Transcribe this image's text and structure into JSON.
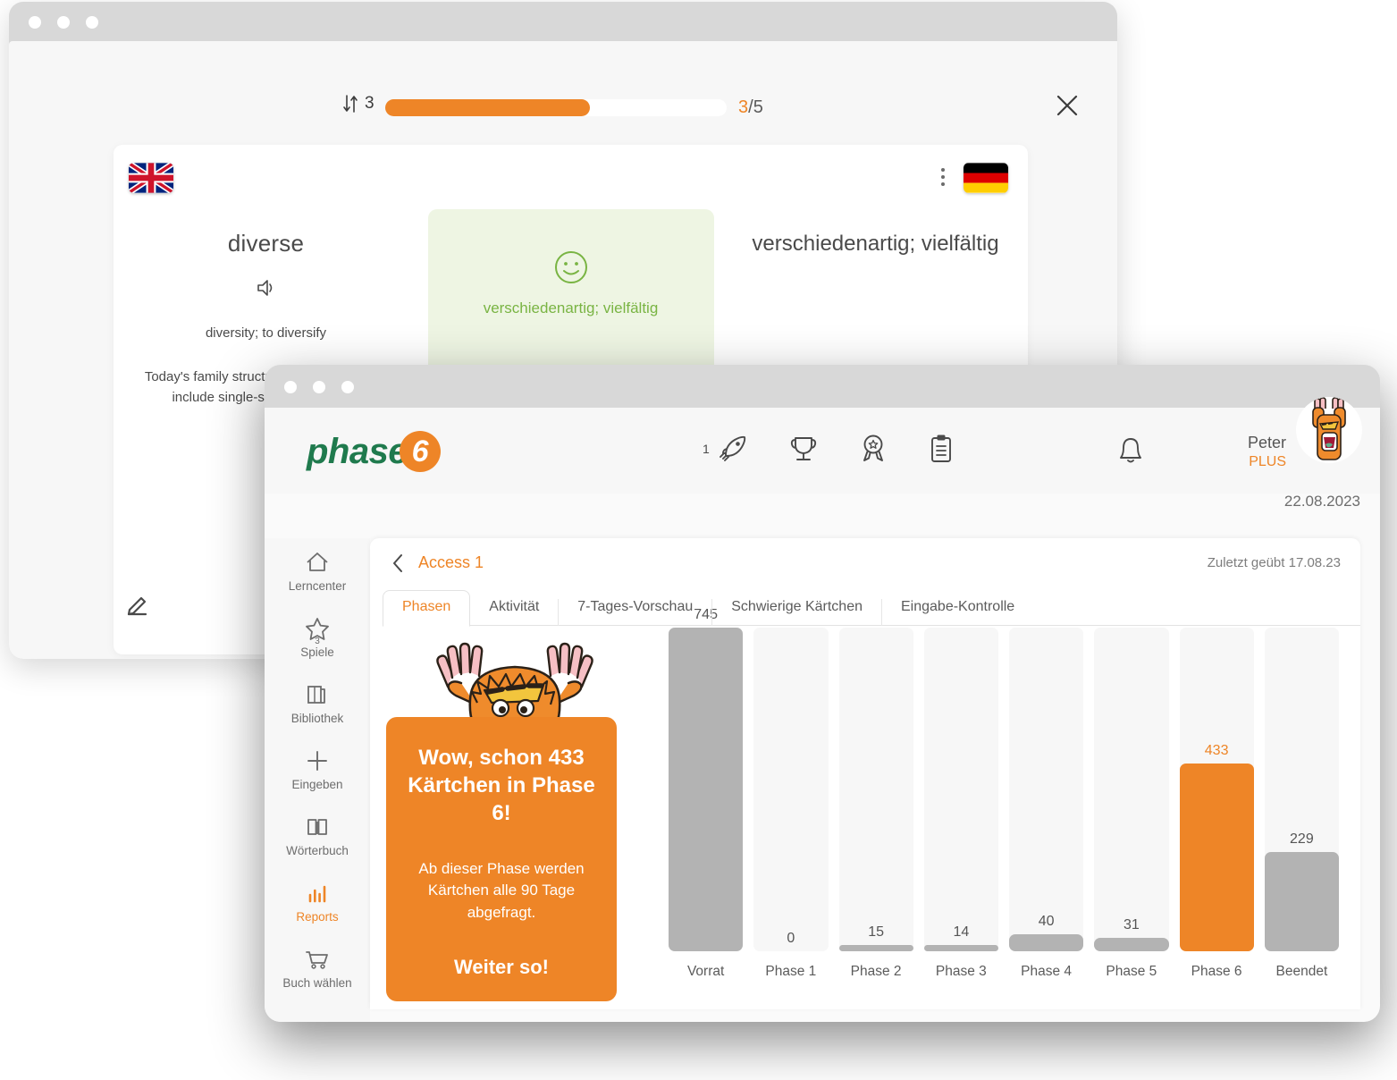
{
  "window_flashcard": {
    "title_dots": [
      "dot",
      "dot",
      "dot"
    ],
    "progress": {
      "shuffle_icon": "sort-arrows-icon",
      "shuffle_count": "3",
      "current": "3",
      "separator": "/",
      "total": "5",
      "percent": 60,
      "fill_color": "#ee8527"
    },
    "close_label": "close-icon",
    "card": {
      "source_flag": "uk-flag",
      "target_flag": "de-flag",
      "menu_icon": "kebab-menu-icon",
      "left": {
        "term": "diverse",
        "audio_icon": "speaker-icon",
        "related": "diversity; to diversify",
        "example": "Today's family structures are diverse and include single-sex partnerships."
      },
      "middle": {
        "smiley_icon": "smiley-face-icon",
        "answer": "verschiedenartig; vielfältig",
        "bg_color": "#eef5e3",
        "text_color": "#79b443"
      },
      "right": {
        "answer": "verschiedenartig; vielfältig"
      },
      "edit_icon": "pencil-icon"
    }
  },
  "window_app": {
    "logo": {
      "word": "phase",
      "digit": "6",
      "word_color": "#1f7a4d",
      "digit_bg": "#ee8527"
    },
    "header_icons": [
      {
        "name": "rocket-icon",
        "badge": "1"
      },
      {
        "name": "trophy-icon",
        "badge": ""
      },
      {
        "name": "medal-icon",
        "badge": ""
      },
      {
        "name": "clipboard-icon",
        "badge": ""
      }
    ],
    "bell_icon": "bell-icon",
    "user": {
      "name": "Peter",
      "plan": "PLUS",
      "avatar": "monster-avatar"
    },
    "today_date": "22.08.2023",
    "sidebar": {
      "items": [
        {
          "label": "Lerncenter",
          "icon": "home-icon",
          "active": false,
          "badge": ""
        },
        {
          "label": "Spiele",
          "icon": "star-icon",
          "active": false,
          "badge": "3"
        },
        {
          "label": "Bibliothek",
          "icon": "books-icon",
          "active": false,
          "badge": ""
        },
        {
          "label": "Eingeben",
          "icon": "plus-icon",
          "active": false,
          "badge": ""
        },
        {
          "label": "Wörterbuch",
          "icon": "open-book-icon",
          "active": false,
          "badge": ""
        },
        {
          "label": "Reports",
          "icon": "bar-chart-icon",
          "active": true,
          "badge": ""
        },
        {
          "label": "Buch wählen",
          "icon": "shopping-cart-icon",
          "active": false,
          "badge": ""
        }
      ]
    },
    "content": {
      "back_icon": "chevron-left-icon",
      "breadcrumb": "Access 1",
      "last_practiced": "Zuletzt geübt 17.08.23",
      "tabs": [
        {
          "label": "Phasen",
          "active": true
        },
        {
          "label": "Aktivität",
          "active": false
        },
        {
          "label": "7-Tages-Vorschau",
          "active": false
        },
        {
          "label": "Schwierige Kärtchen",
          "active": false
        },
        {
          "label": "Eingabe-Kontrolle",
          "active": false
        }
      ],
      "promo": {
        "mascot": "monster-mascot",
        "headline": "Wow, schon 433 Kärtchen in Phase 6!",
        "body": "Ab dieser Phase werden Kärtchen alle 90 Tage abgefragt.",
        "cta": "Weiter so!",
        "bg_color": "#ee8527"
      }
    }
  },
  "chart_data": {
    "type": "bar",
    "title": "",
    "xlabel": "",
    "ylabel": "",
    "categories": [
      "Vorrat",
      "Phase 1",
      "Phase 2",
      "Phase 3",
      "Phase 4",
      "Phase 5",
      "Phase 6",
      "Beendet"
    ],
    "values": [
      745,
      0,
      15,
      14,
      40,
      31,
      433,
      229
    ],
    "highlight_index": 6,
    "highlight_color": "#ee8527",
    "bar_color": "#b3b3b3",
    "track_color": "#f7f7f7",
    "ylim": [
      0,
      745
    ],
    "grid": false,
    "legend": "none"
  }
}
